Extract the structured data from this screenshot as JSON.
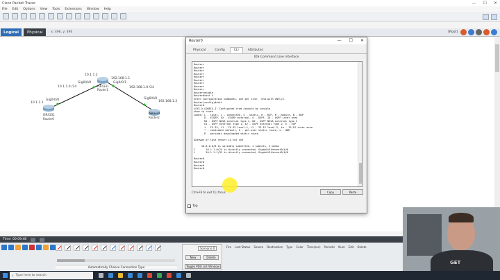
{
  "app": {
    "title": "Cisco Packet Tracer",
    "window_controls": [
      "—",
      "☐",
      "✕"
    ]
  },
  "menu": [
    "File",
    "Edit",
    "Options",
    "View",
    "Tools",
    "Extensions",
    "Window",
    "Help"
  ],
  "workspace": {
    "logical_label": "Logical",
    "physical_label": "Physical",
    "coords": "x: 496, y: 496",
    "root_label": "[Root]"
  },
  "topology": {
    "labels": {
      "r0_net": "10.1.1.1",
      "r0_if": "Gig0/0/0",
      "r1_net": "10.1.1.2",
      "r1_if0": "Gig0/0/0",
      "r1_if1": "Gig0/0/1",
      "r1_net2": "192.168.1.1",
      "link1": "10.1.1.0 /24",
      "link2": "192.168.1.0 /24",
      "r2_if": "Gig0/0/0",
      "r2_net": "192.168.1.2"
    },
    "devices": {
      "r0_model": "ISR4331",
      "r0_name": "Router0",
      "r1_model": "ISR4331",
      "r1_name": "Router1",
      "r2_model": "ISR4331",
      "r2_name": "Router2"
    }
  },
  "dialog": {
    "title": "Router0",
    "tabs": [
      "Physical",
      "Config",
      "CLI",
      "Attributes"
    ],
    "active_tab": "CLI",
    "cli_title": "IOS Command Line Interface",
    "cli_text": "Router>\nRouter>\nRouter>\nRouter>\nRouter>\nRouter>\nRouter>\nRouter>\nRouter>\nRouter>enable\nRouter#conf t\nEnter configuration commands, one per line.  End with CNTL/Z.\nRouter(config)#exit\nRouter#\n%SYS-5-CONFIG_I: Configured from console by console\nshow ip route\nCodes: L - local, C - connected, S - static, R - RIP, M - mobile, B - BGP\n       D - EIGRP, EX - EIGRP external, O - OSPF, IA - OSPF inter area\n       N1 - OSPF NSSA external type 1, N2 - OSPF NSSA external type 2\n       E1 - OSPF external type 1, E2 - OSPF external type 2, E - EGP\n       i - IS-IS, L1 - IS-IS level-1, L2 - IS-IS level-2, ia - IS-IS inter area\n       * - candidate default, U - per-user static route, o - ODR\n       P - periodic downloaded static route\n\nGateway of last resort is not set\n\n     10.0.0.0/8 is variably subnetted, 2 subnets, 2 masks\nC       10.1.1.0/24 is directly connected, GigabitEthernet0/0/0\nL       10.1.1.1/32 is directly connected, GigabitEthernet0/0/0\n\nRouter#\nRouter#\nRouter#\nRouter#",
    "hint": "Ctrl+F6 to exit CLI focus",
    "copy_label": "Copy",
    "paste_label": "Paste",
    "top_label": "Top"
  },
  "bottom": {
    "time": "Time: 00:09:48",
    "auto_connection": "Automatically Choose Connection Type",
    "scenario": "Scenario 0",
    "new_label": "New",
    "delete_label": "Delete",
    "toggle_pdu": "Toggle PDU List Window",
    "pdu_columns": [
      "Fire",
      "Last Status",
      "Source",
      "Destination",
      "Type",
      "Color",
      "Time(sec)",
      "Periodic",
      "Num",
      "Edit",
      "Delete"
    ]
  },
  "webcam": {
    "shirt_text": "GET"
  },
  "taskbar": {
    "search_placeholder": "Type here to search"
  }
}
